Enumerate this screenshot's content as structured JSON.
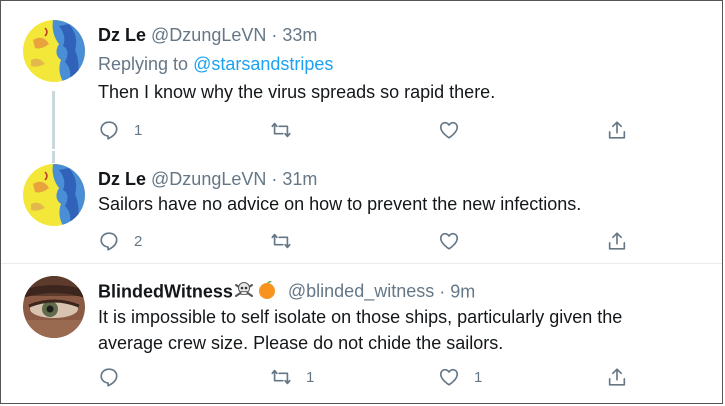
{
  "tweets": [
    {
      "name": "Dz Le",
      "handle": "@DzungLeVN",
      "sep": "·",
      "time": "33m",
      "replying_prefix": "Replying to",
      "replying_to": "@starsandstripes",
      "text": "Then I know why the virus spreads so rapid there.",
      "reply_count": "1",
      "retweet_count": "",
      "like_count": ""
    },
    {
      "name": "Dz Le",
      "handle": "@DzungLeVN",
      "sep": "·",
      "time": "31m",
      "text": "Sailors have no advice on how to prevent the new infections.",
      "reply_count": "2",
      "retweet_count": "",
      "like_count": ""
    },
    {
      "name": "BlindedWitness",
      "handle": "@blinded_witness",
      "sep": "·",
      "time": "9m",
      "text_line1": "It is impossible to self isolate on those ships, particularly given the",
      "text_line2": "average crew size. Please do not chide the sailors.",
      "reply_count": "",
      "retweet_count": "1",
      "like_count": "1"
    }
  ],
  "icons": [
    "reply-icon",
    "retweet-icon",
    "like-icon",
    "share-icon",
    "skull-crossbones-icon",
    "orange-icon"
  ],
  "colors": {
    "link": "#1da1f2",
    "muted": "#657786",
    "text": "#14171a",
    "thread": "#ccd6dd"
  }
}
